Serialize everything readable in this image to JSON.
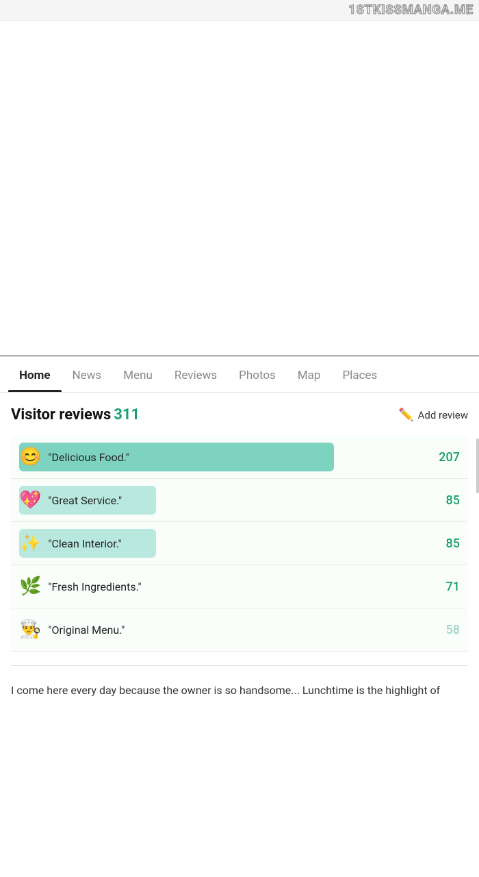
{
  "watermark": {
    "text": "1STKISSMANGA.ME"
  },
  "nav": {
    "tabs": [
      {
        "id": "home",
        "label": "Home",
        "active": true
      },
      {
        "id": "news",
        "label": "News",
        "active": false
      },
      {
        "id": "menu",
        "label": "Menu",
        "active": false
      },
      {
        "id": "reviews",
        "label": "Reviews",
        "active": false
      },
      {
        "id": "photos",
        "label": "Photos",
        "active": false
      },
      {
        "id": "map",
        "label": "Map",
        "active": false
      },
      {
        "id": "places",
        "label": "Places",
        "active": false
      }
    ]
  },
  "visitor_reviews": {
    "title": "Visitor reviews",
    "count": "311",
    "add_review_label": "Add review",
    "items": [
      {
        "emoji": "😊",
        "label": "\"Delicious Food.\"",
        "count": "207",
        "faded": false
      },
      {
        "emoji": "💖",
        "label": "\"Great Service.\"",
        "count": "85",
        "faded": false
      },
      {
        "emoji": "✨",
        "label": "\"Clean Interior.\"",
        "count": "85",
        "faded": false
      },
      {
        "emoji": "🌿",
        "label": "\"Fresh Ingredients.\"",
        "count": "71",
        "faded": false
      },
      {
        "emoji": "👨‍🍳",
        "label": "\"Original Menu.\"",
        "count": "58",
        "faded": true
      }
    ]
  },
  "review_snippet": {
    "text": "I come here every day because the owner is so handsome... Lunchtime is the highlight of"
  }
}
